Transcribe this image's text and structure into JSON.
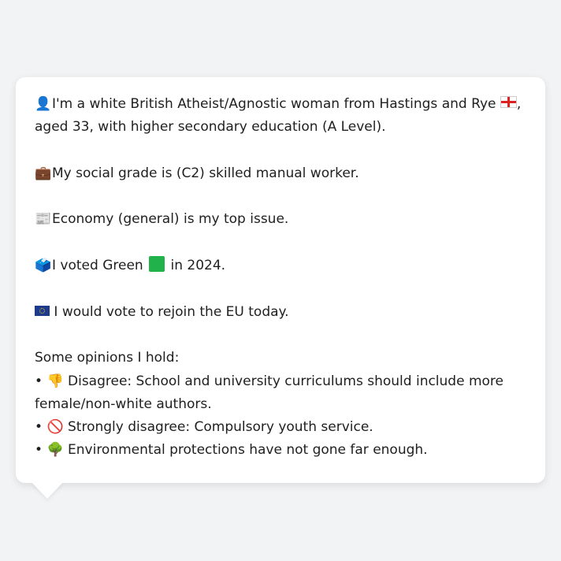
{
  "persona": {
    "intro": {
      "icon": "person-silhouette-icon",
      "text_before_flag": "I'm a white British Atheist/Agnostic woman from Hastings and Rye",
      "flag": "england-flag-icon",
      "text_after_flag": ", aged 33, with higher secondary education (A Level)."
    },
    "social_grade": {
      "icon": "briefcase-icon",
      "text": "My social grade is (C2) skilled manual worker."
    },
    "top_issue": {
      "icon": "newspaper-icon",
      "text": "Economy (general) is my top issue."
    },
    "vote": {
      "icon": "ballot-box-icon",
      "text_before": "I voted Green",
      "party_color": "#22b24c",
      "text_after": "in 2024."
    },
    "eu": {
      "icon": "eu-flag-icon",
      "text": "I would vote to rejoin the EU today."
    },
    "opinions_heading": "Some opinions I hold:",
    "opinions": [
      {
        "bullet": "•",
        "icon": "thumbs-down-icon",
        "glyph": "👎",
        "text": "Disagree: School and university curriculums should include more female/non-white authors."
      },
      {
        "bullet": "•",
        "icon": "prohibited-icon",
        "glyph": "🚫",
        "text": "Strongly disagree: Compulsory youth service."
      },
      {
        "bullet": "•",
        "icon": "tree-icon",
        "glyph": "🌳",
        "text": "Environmental protections have not gone far enough."
      }
    ]
  },
  "glyphs": {
    "person": "👤",
    "briefcase": "💼",
    "newspaper": "📰",
    "ballot": "🗳️"
  }
}
